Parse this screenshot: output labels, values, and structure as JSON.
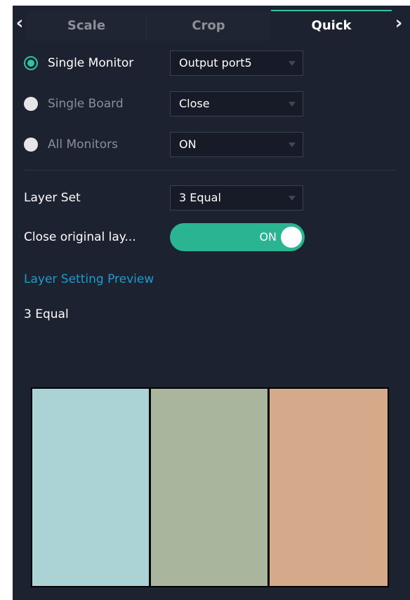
{
  "tabs": {
    "items": [
      "Scale",
      "Crop",
      "Quick"
    ],
    "active": "Quick"
  },
  "icons": {
    "left": "chevron-left-icon",
    "right": "chevron-right-icon",
    "dropdown": "caret-down-icon"
  },
  "modes": [
    {
      "label": "Single Monitor",
      "selected": true,
      "value": "Output port5"
    },
    {
      "label": "Single Board",
      "selected": false,
      "value": "Close"
    },
    {
      "label": "All Monitors",
      "selected": false,
      "value": "ON"
    }
  ],
  "layer_set": {
    "label": "Layer Set",
    "value": "3 Equal"
  },
  "close_original": {
    "label": "Close original lay...",
    "state": "ON"
  },
  "preview": {
    "title": "Layer Setting Preview",
    "value": "3 Equal",
    "panes": [
      {
        "color": "#abd3d6"
      },
      {
        "color": "#a9b59c"
      },
      {
        "color": "#d5aa8b"
      }
    ]
  },
  "colors": {
    "accent": "#2ec4a0",
    "background": "#1c2230",
    "link": "#1f9bd0"
  }
}
